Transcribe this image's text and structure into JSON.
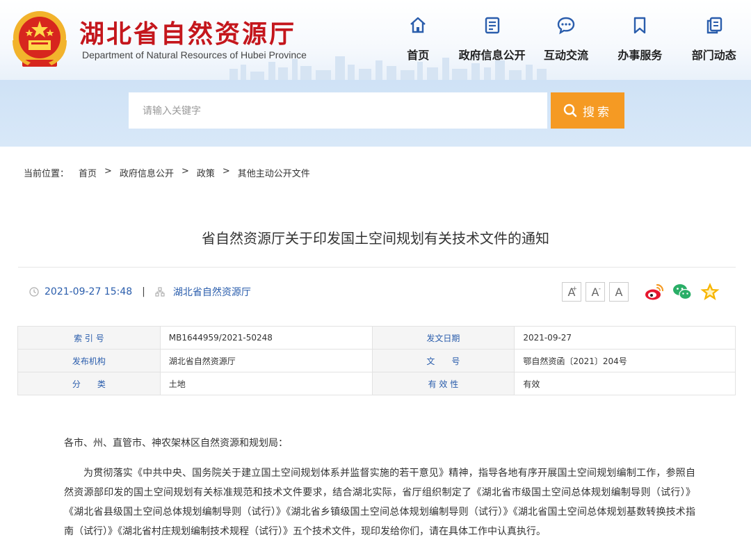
{
  "site": {
    "name_cn": "湖北省自然资源厅",
    "name_en": "Department of Natural Resources of Hubei Province"
  },
  "nav": [
    {
      "label": "首页",
      "icon": "home-icon"
    },
    {
      "label": "政府信息公开",
      "icon": "document-icon"
    },
    {
      "label": "互动交流",
      "icon": "chat-icon"
    },
    {
      "label": "办事服务",
      "icon": "bookmark-icon"
    },
    {
      "label": "部门动态",
      "icon": "copy-icon"
    }
  ],
  "search": {
    "placeholder": "请输入关键字",
    "button_label": "搜索"
  },
  "breadcrumb": {
    "prefix": "当前位置：",
    "items": [
      "首页",
      "政府信息公开",
      "政策",
      "其他主动公开文件"
    ],
    "separator": ">"
  },
  "article": {
    "title": "省自然资源厅关于印发国土空间规划有关技术文件的通知",
    "datetime": "2021-09-27 15:48",
    "meta_separator": "|",
    "source": "湖北省自然资源厅",
    "font_buttons": [
      "A",
      "A",
      "A"
    ],
    "font_sup": "+",
    "font_sub": "-"
  },
  "info": {
    "rows": [
      {
        "k1": "索 引 号",
        "v1": "MB1644959/2021-50248",
        "k2": "发文日期",
        "v2": "2021-09-27"
      },
      {
        "k1": "发布机构",
        "v1": "湖北省自然资源厅",
        "k2": "文　　号",
        "v2": "鄂自然资函〔2021〕204号"
      },
      {
        "k1": "分　　类",
        "v1": "土地",
        "k2": "有 效 性",
        "v2": "有效"
      }
    ]
  },
  "body": {
    "greeting": "各市、州、直管市、神农架林区自然资源和规划局：",
    "paragraph": "为贯彻落实《中共中央、国务院关于建立国土空间规划体系并监督实施的若干意见》精神，指导各地有序开展国土空间规划编制工作，参照自然资源部印发的国土空间规划有关标准规范和技术文件要求，结合湖北实际，省厅组织制定了《湖北省市级国土空间总体规划编制导则（试行）》《湖北省县级国土空间总体规划编制导则（试行）》《湖北省乡镇级国土空间总体规划编制导则（试行）》《湖北省国土空间总体规划基数转换技术指南（试行）》《湖北省村庄规划编制技术规程（试行）》五个技术文件，现印发给你们，请在具体工作中认真执行。"
  },
  "colors": {
    "brand_red": "#c4161c",
    "nav_blue": "#2a5dac",
    "search_orange": "#f59a23",
    "weibo": "#e6162d",
    "wechat": "#2aae67",
    "favorite": "#f7b500"
  }
}
